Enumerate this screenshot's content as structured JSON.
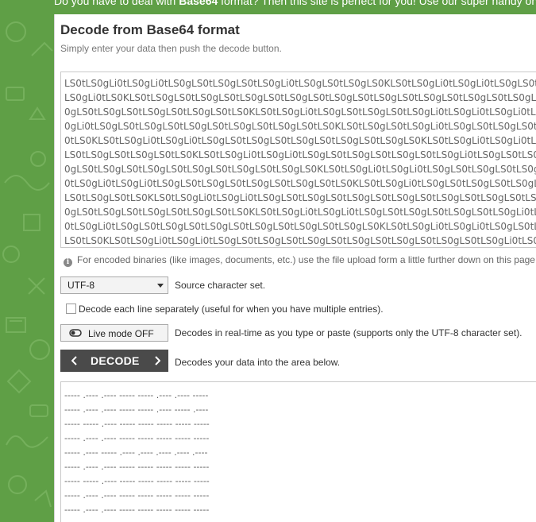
{
  "banner": {
    "pre": "Do you have to deal with ",
    "bold": "Base64",
    "post": " format? Then this site is perfect for you! Use our super handy online tool to encode or decode your data."
  },
  "page": {
    "title": "Decode from Base64 format",
    "subtitle": "Simply enter your data then push the decode button."
  },
  "input": {
    "lines": [
      "LS0tLS0gLi0tLS0gLi0tLS0gLS0tLS0gLS0tLS0gLi0tLS0gLS0tLS0gLS0KLS0tLS0gLi0tLS0gLi0tLS0gLS0tLS0gLS0tLS0gLS0t",
      "LS0gLi0tLS0KLS0tLS0gLS0tLS0gLS0tLS0gLS0tLS0gLS0tLS0gLS0tLS0gLS0tLS0gLS0tLS0gLS0tLS0gLS0tLS0gLS0KLS0tLS0g",
      "0gLS0tLS0gLS0tLS0gLS0tLS0gLS0tLS0KLS0tLS0gLi0tLS0gLS0tLS0gLS0tLS0gLi0tLS0gLi0tLS0gLi0tLS0gLS0tLS0gLS0tLS0",
      "0gLi0tLS0gLS0tLS0gLS0tLS0gLS0tLS0gLS0tLS0gLS0tLS0KLS0tLS0gLS0tLS0gLi0tLS0gLS0tLS0gLS0tLS0gLS0tLS0gLS0tLS0",
      "0tLS0KLS0tLS0gLi0tLS0gLi0tLS0gLS0tLS0gLS0tLS0gLS0tLS0gLS0tLS0gLS0KLS0tLS0gLi0tLS0gLi0tLS0gLS0tLS0gLS0tLS0",
      "LS0tLS0gLS0tLS0gLS0tLS0KLS0tLS0gLi0tLS0gLi0tLS0gLS0tLS0gLS0tLS0gLS0tLS0gLi0tLS0gLS0tLS0gLi0tLS0gLS0tLS0gLS0",
      "0gLS0tLS0gLS0tLS0gLS0tLS0gLS0tLS0gLS0tLS0gLS0KLS0tLS0gLi0tLS0gLi0tLS0gLS0tLS0gLS0tLS0gLS0tLS0gLS0tLS0gLS0t",
      "0tLS0gLi0tLS0gLi0tLS0gLS0tLS0gLS0tLS0gLS0tLS0gLS0tLS0KLS0tLS0gLi0tLS0gLS0tLS0gLS0tLS0gLi0tLS0gLi0tLS0gLS0t",
      "LS0tLS0gLS0tLS0KLS0tLS0gLi0tLS0gLi0tLS0gLS0tLS0gLS0tLS0gLS0tLS0gLS0tLS0gLS0tLS0gLS0tLS0gLS0KLS0tLS0gLi0tLS0",
      "0gLS0tLS0gLS0tLS0gLS0tLS0gLS0tLS0KLS0tLS0gLi0tLS0gLi0tLS0gLS0tLS0gLS0tLS0gLS0tLS0gLi0tLS0gLS0tLS0gLS0tLS0g",
      "0tLS0gLi0tLS0gLS0tLS0gLS0tLS0gLS0tLS0gLS0tLS0gLS0tLS0gLS0KLS0tLS0gLi0tLS0gLi0tLS0gLS0tLS0gLS0tLS0gLS0tLS0",
      "LS0tLS0KLS0tLS0gLi0tLS0gLi0tLS0gLS0tLS0gLS0tLS0gLS0tLS0gLS0tLS0gLS0tLS0gLS0tLS0gLi0tLS0KLS0tLS0gLS0tLS0gLS0"
    ]
  },
  "info": {
    "icon": "info-icon",
    "text": "For encoded binaries (like images, documents, etc.) use the file upload form a little further down on this page."
  },
  "charset": {
    "value": "UTF-8",
    "label": "Source character set."
  },
  "lines_option": {
    "label": "Decode each line separately (useful for when you have multiple entries).",
    "checked": false
  },
  "live_mode": {
    "label": "Live mode OFF",
    "description": "Decodes in real-time as you type or paste (supports only the UTF-8 character set)."
  },
  "decode": {
    "label": "DECODE",
    "description": "Decodes your data into the area below."
  },
  "output": {
    "lines": [
      "----- .---- .---- ----- ----- .---- .---- -----",
      "----- .---- .---- ----- ----- .---- ----- .----",
      "----- ----- .---- ----- ----- ----- ----- -----",
      "----- .---- .---- ----- ----- ----- ----- -----",
      "----- .---- ----- .---- .---- .---- .---- .----",
      "----- .---- .---- ----- ----- ----- ----- -----",
      "----- ----- .---- ----- ----- ----- ----- -----",
      "----- .---- .---- ----- ----- ----- ----- -----",
      "----- .---- .---- ----- ----- ----- ----- -----",
      "----- .---- .---- ----- ----- .---- ----- .----"
    ]
  },
  "colors": {
    "sidebar": "#5f9f46",
    "button": "#4a4a4a"
  }
}
